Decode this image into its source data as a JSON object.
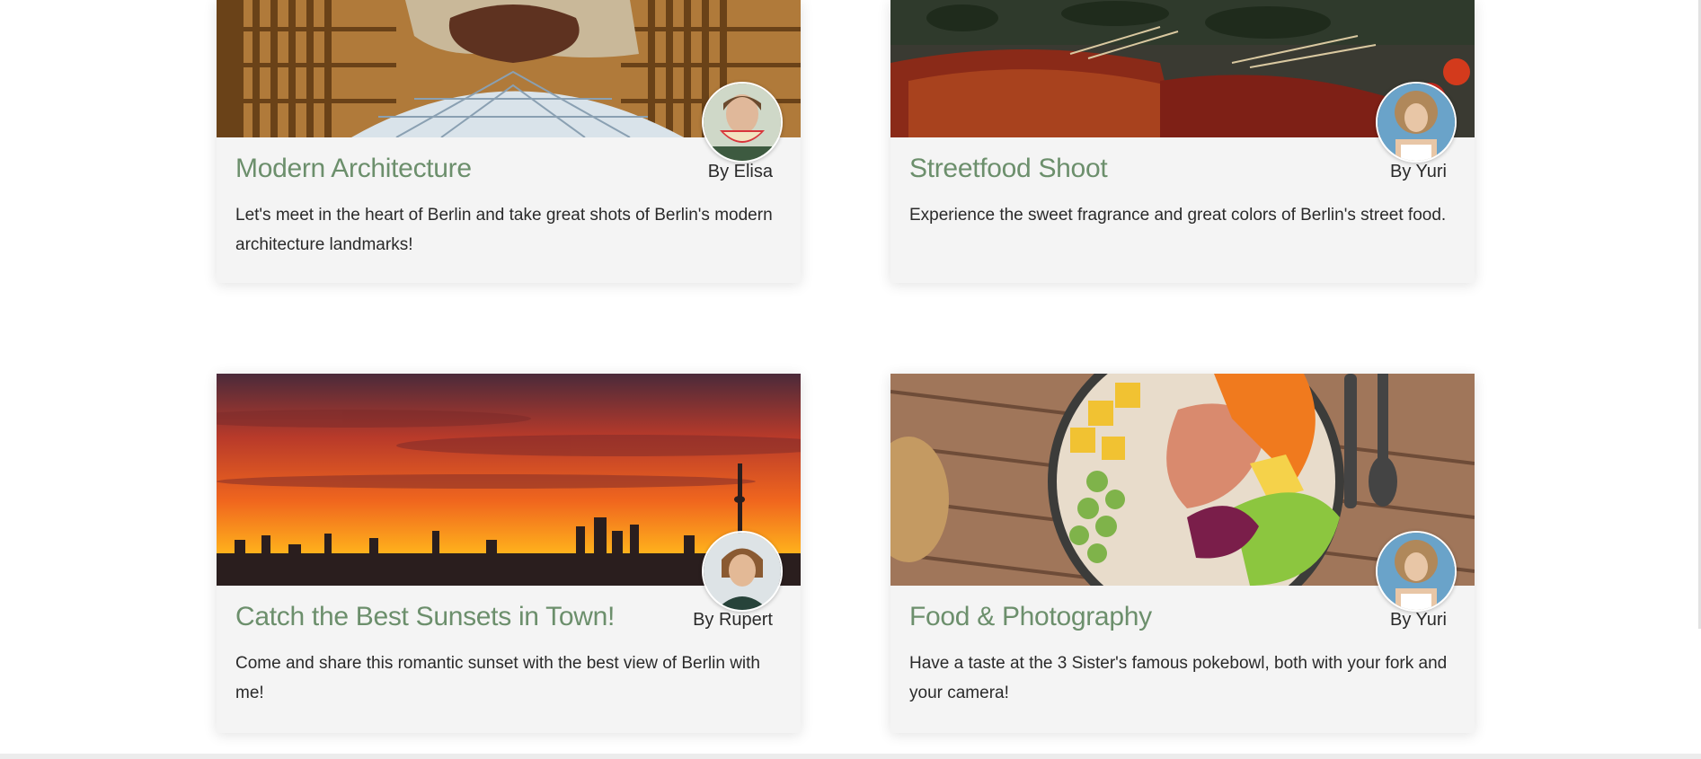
{
  "cards": [
    {
      "title": "Modern Architecture",
      "author": "By Elisa",
      "description": "Let's meet in the heart of Berlin and take great shots of Berlin's modern architecture landmarks!",
      "image_icon": "architecture-photo",
      "avatar_icon": "avatar-elisa"
    },
    {
      "title": "Streetfood Shoot",
      "author": "By Yuri",
      "description": "Experience the sweet fragrance and great colors of Berlin's street food.",
      "image_icon": "streetfood-photo",
      "avatar_icon": "avatar-yuri"
    },
    {
      "title": "Catch the Best Sunsets in Town!",
      "author": "By Rupert",
      "description": "Come and share this romantic sunset with the best view of Berlin with me!",
      "image_icon": "sunset-skyline-photo",
      "avatar_icon": "avatar-rupert"
    },
    {
      "title": "Food & Photography",
      "author": "By Yuri",
      "description": "Have a taste at the 3 Sister's famous pokebowl, both with your fork and your camera!",
      "image_icon": "pokebowl-photo",
      "avatar_icon": "avatar-yuri"
    }
  ],
  "colors": {
    "title_green": "#6c8f6c",
    "card_bg": "#f4f4f4",
    "text": "#2a2a2a"
  }
}
